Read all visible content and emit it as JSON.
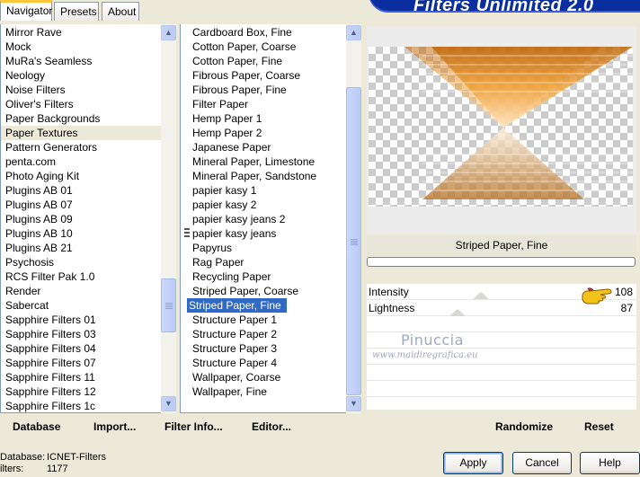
{
  "tabs": [
    {
      "label": "Navigator"
    },
    {
      "label": "Presets"
    },
    {
      "label": "About"
    }
  ],
  "banner_title": "Filters Unlimited 2.0",
  "categories": [
    "Mirror Rave",
    "Mock",
    "MuRa's Seamless",
    "Neology",
    "Noise Filters",
    "Oliver's Filters",
    "Paper Backgrounds",
    "Paper Textures",
    "Pattern Generators",
    "penta.com",
    "Photo Aging Kit",
    "Plugins AB 01",
    "Plugins AB 07",
    "Plugins AB 09",
    "Plugins AB 10",
    "Plugins AB 21",
    "Psychosis",
    "RCS Filter Pak 1.0",
    "Render",
    "Sabercat",
    "Sapphire Filters 01",
    "Sapphire Filters 03",
    "Sapphire Filters 04",
    "Sapphire Filters 07",
    "Sapphire Filters 11",
    "Sapphire Filters 12",
    "Sapphire Filters 1c"
  ],
  "selected_category": "Paper Textures",
  "filters": [
    "Cardboard Box, Fine",
    "Cotton Paper, Coarse",
    "Cotton Paper, Fine",
    "Fibrous Paper, Coarse",
    "Fibrous Paper, Fine",
    "Filter Paper",
    "Hemp Paper 1",
    "Hemp Paper 2",
    "Japanese Paper",
    "Mineral Paper, Limestone",
    "Mineral Paper, Sandstone",
    "papier kasy 1",
    "papier kasy 2",
    "papier kasy jeans 2",
    "papier kasy jeans",
    "Papyrus",
    "Rag Paper",
    "Recycling Paper",
    "Striped Paper, Coarse",
    "Striped Paper, Fine",
    "Structure Paper 1",
    "Structure Paper 2",
    "Structure Paper 3",
    "Structure Paper 4",
    "Wallpaper, Coarse",
    "Wallpaper, Fine"
  ],
  "selected_filter": "Striped Paper, Fine",
  "filter_name": "Striped Paper, Fine",
  "params": [
    {
      "label": "Intensity",
      "value": "108"
    },
    {
      "label": "Lightness",
      "value": "87"
    }
  ],
  "watermark": {
    "name": "Pinuccia",
    "url": "www.maidiregrafica.eu"
  },
  "toolbar": {
    "database": "Database",
    "import": "Import...",
    "filter_info": "Filter Info...",
    "editor": "Editor...",
    "randomize": "Randomize",
    "reset": "Reset"
  },
  "status": {
    "database_label": "Database:",
    "database_value": "ICNET-Filters",
    "filters_label": "ilters:",
    "filters_value": "1177"
  },
  "buttons": {
    "apply": "Apply",
    "cancel": "Cancel",
    "help": "Help"
  },
  "colors": {
    "selection_blue": "#316ac5",
    "dialog_bg": "#ece9d8",
    "banner_blue": "#0a2e9e"
  }
}
